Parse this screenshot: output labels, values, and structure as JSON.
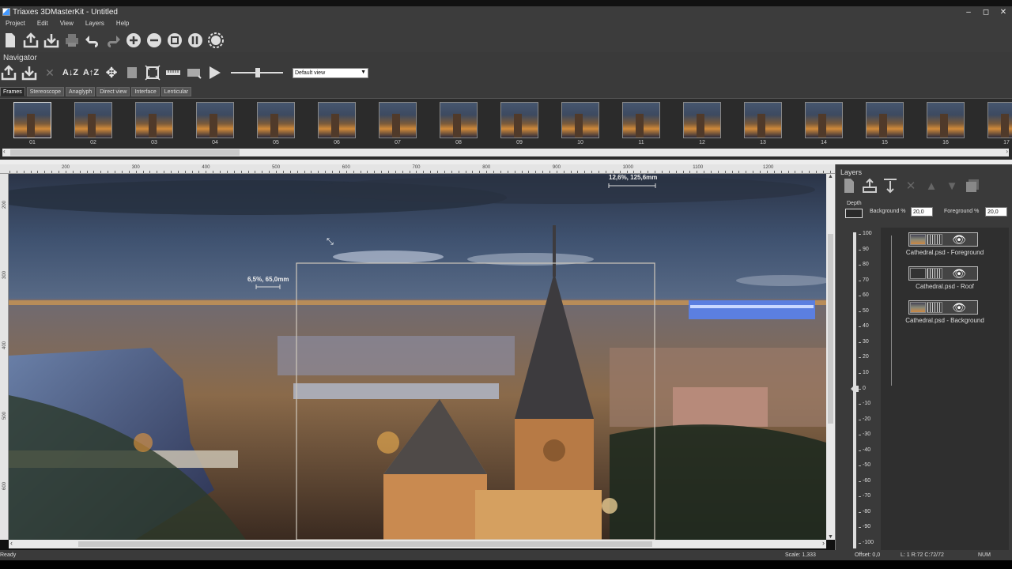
{
  "window": {
    "title": "Triaxes 3DMasterKit - Untitled",
    "controls": [
      "–",
      "◻",
      "✕"
    ]
  },
  "menu": [
    "Project",
    "Edit",
    "View",
    "Layers",
    "Help"
  ],
  "navigator": {
    "title": "Navigator",
    "view_select": "Default view",
    "tabs": [
      "Frames",
      "Stereoscope",
      "Anaglyph",
      "Direct view",
      "Interface",
      "Lenticular"
    ],
    "active_tab": "Frames"
  },
  "frames": [
    "01",
    "02",
    "03",
    "04",
    "05",
    "06",
    "07",
    "08",
    "09",
    "10",
    "11",
    "12",
    "13",
    "14",
    "15",
    "16",
    "17"
  ],
  "selected_frame": "01",
  "ruler": {
    "h_labels": [
      "200",
      "300",
      "400",
      "500",
      "600",
      "700",
      "800",
      "900",
      "1000",
      "1100",
      "1200"
    ],
    "v_labels": [
      "200",
      "300",
      "400",
      "500",
      "600"
    ]
  },
  "canvas": {
    "measure_top": "12,6%, 125,6mm",
    "measure_left": "6,5%, 65,0mm"
  },
  "layers": {
    "title": "Layers",
    "depth_label": "Depth",
    "background_label": "Background %",
    "background_value": "20,0",
    "foreground_label": "Foreground %",
    "foreground_value": "20,0",
    "scale": [
      "100",
      "90",
      "80",
      "70",
      "60",
      "50",
      "40",
      "30",
      "20",
      "10",
      "0",
      "-10",
      "-20",
      "-30",
      "-40",
      "-50",
      "-60",
      "-70",
      "-80",
      "-90",
      "-100"
    ],
    "items": [
      {
        "name": "Cathedral.psd - Foreground"
      },
      {
        "name": "Cathedral.psd - Roof"
      },
      {
        "name": "Cathedral.psd - Background"
      }
    ]
  },
  "status": {
    "left": "Ready",
    "scale": "Scale: 1,333",
    "offset": "Offset: 0,0",
    "position": "L: 1  R:72  C:72/72",
    "num": "NUM"
  }
}
